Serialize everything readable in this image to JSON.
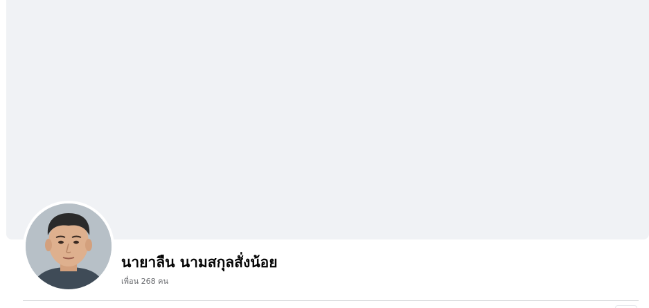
{
  "profile": {
    "name": "นายาลืน นามสกุลสั่งน้อย",
    "friends_text": "เพื่อน 268 คน"
  },
  "colors": {
    "cover_background": "#f0f2f5",
    "name_text": "#050505",
    "secondary_text": "#65676b",
    "divider": "#ced0d4"
  }
}
